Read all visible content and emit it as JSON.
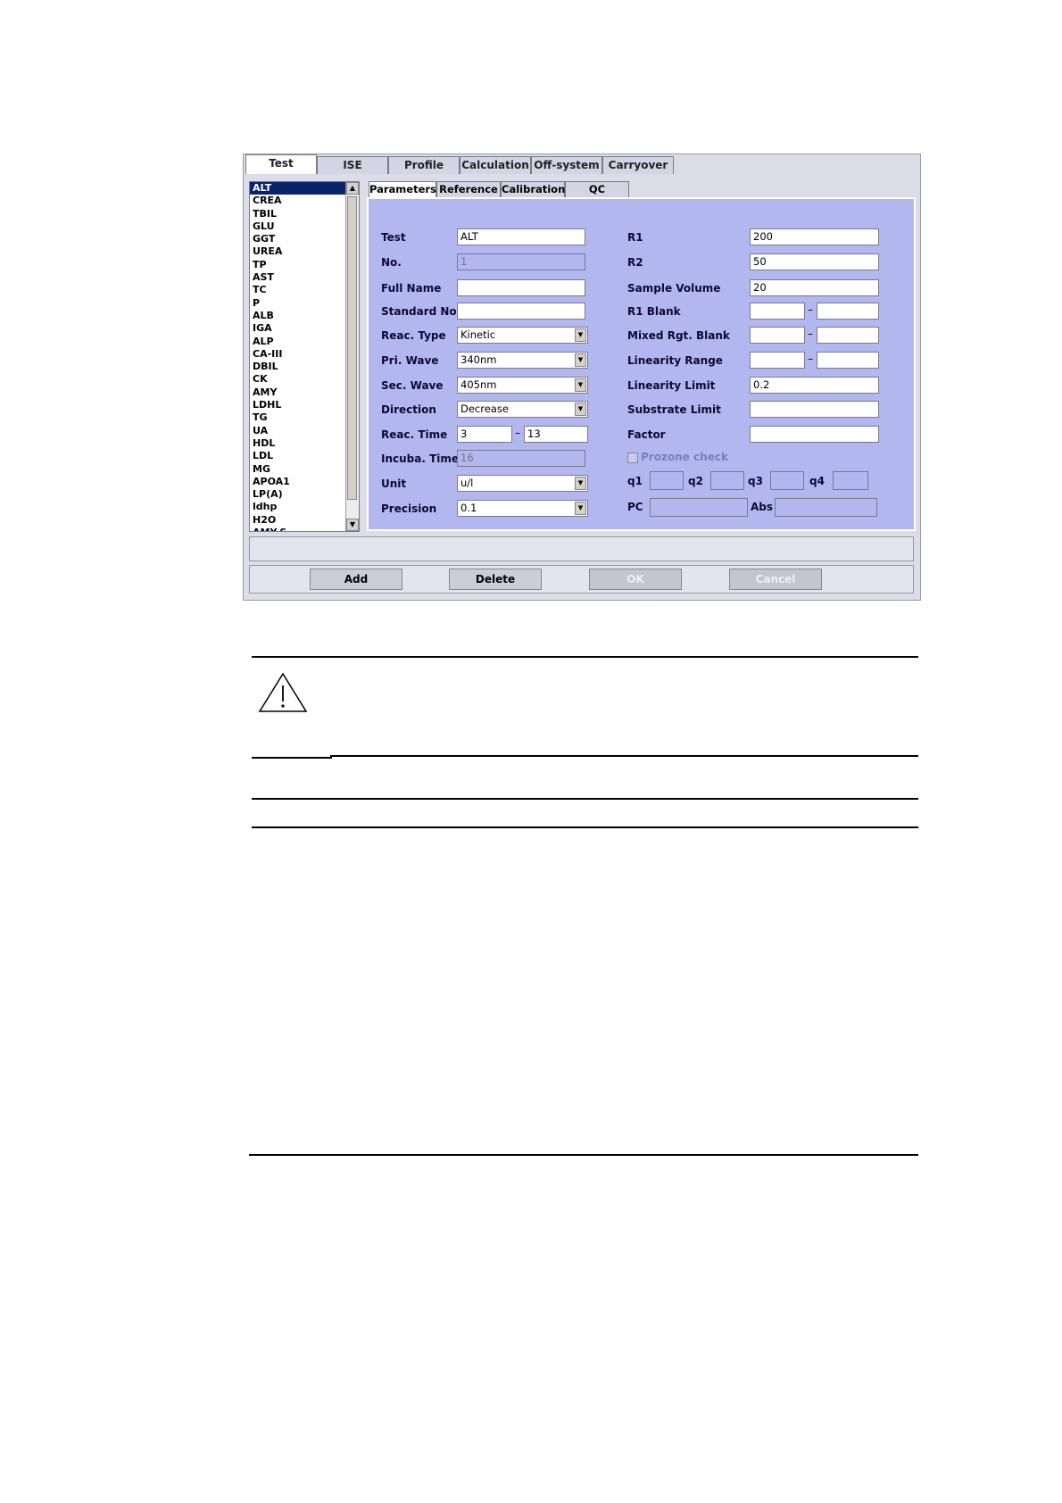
{
  "top_tabs": [
    "Test",
    "ISE",
    "Profile",
    "Calculation",
    "Off-system",
    "Carryover"
  ],
  "tests": [
    "ALT",
    "CREA",
    "TBIL",
    "GLU",
    "GGT",
    "UREA",
    "TP",
    "AST",
    "TC",
    "P",
    "ALB",
    "IGA",
    "ALP",
    "CA-III",
    "DBIL",
    "CK",
    "AMY",
    "LDHL",
    "TG",
    "UA",
    "HDL",
    "LDL",
    "MG",
    "APOA1",
    "LP(A)",
    "ldhp",
    "H2O",
    "AMY-S"
  ],
  "selected_test": "ALT",
  "sub_tabs": [
    "Parameters",
    "Reference",
    "Calibration",
    "QC"
  ],
  "left_fields": {
    "test": {
      "label": "Test",
      "value": "ALT"
    },
    "no": {
      "label": "No.",
      "value": "1"
    },
    "full_name": {
      "label": "Full Name",
      "value": ""
    },
    "standard_no": {
      "label": "Standard No.",
      "value": ""
    },
    "reac_type": {
      "label": "Reac. Type",
      "value": "Kinetic"
    },
    "pri_wave": {
      "label": "Pri. Wave",
      "value": "340nm"
    },
    "sec_wave": {
      "label": "Sec. Wave",
      "value": "405nm"
    },
    "direction": {
      "label": "Direction",
      "value": "Decrease"
    },
    "reac_time": {
      "label": "Reac. Time",
      "from": "3",
      "to": "13"
    },
    "incuba_time": {
      "label": "Incuba. Time",
      "value": "16"
    },
    "unit": {
      "label": "Unit",
      "value": "u/l"
    },
    "precision": {
      "label": "Precision",
      "value": "0.1"
    }
  },
  "right_fields": {
    "r1": {
      "label": "R1",
      "value": "200"
    },
    "r2": {
      "label": "R2",
      "value": "50"
    },
    "sample_volume": {
      "label": "Sample Volume",
      "value": "20"
    },
    "r1_blank": {
      "label": "R1 Blank"
    },
    "mixed_rgt_blank": {
      "label": "Mixed Rgt. Blank"
    },
    "linearity_range": {
      "label": "Linearity Range"
    },
    "linearity_limit": {
      "label": "Linearity Limit",
      "value": "0.2"
    },
    "substrate_limit": {
      "label": "Substrate Limit",
      "value": ""
    },
    "factor": {
      "label": "Factor",
      "value": ""
    },
    "prozone_check": {
      "label": "Prozone check"
    },
    "q_labels": [
      "q1",
      "q2",
      "q3",
      "q4"
    ],
    "pc": {
      "label": "PC"
    },
    "abs": {
      "label": "Abs"
    }
  },
  "buttons": {
    "add": "Add",
    "delete": "Delete",
    "ok": "OK",
    "cancel": "Cancel"
  },
  "range_dash": "–"
}
